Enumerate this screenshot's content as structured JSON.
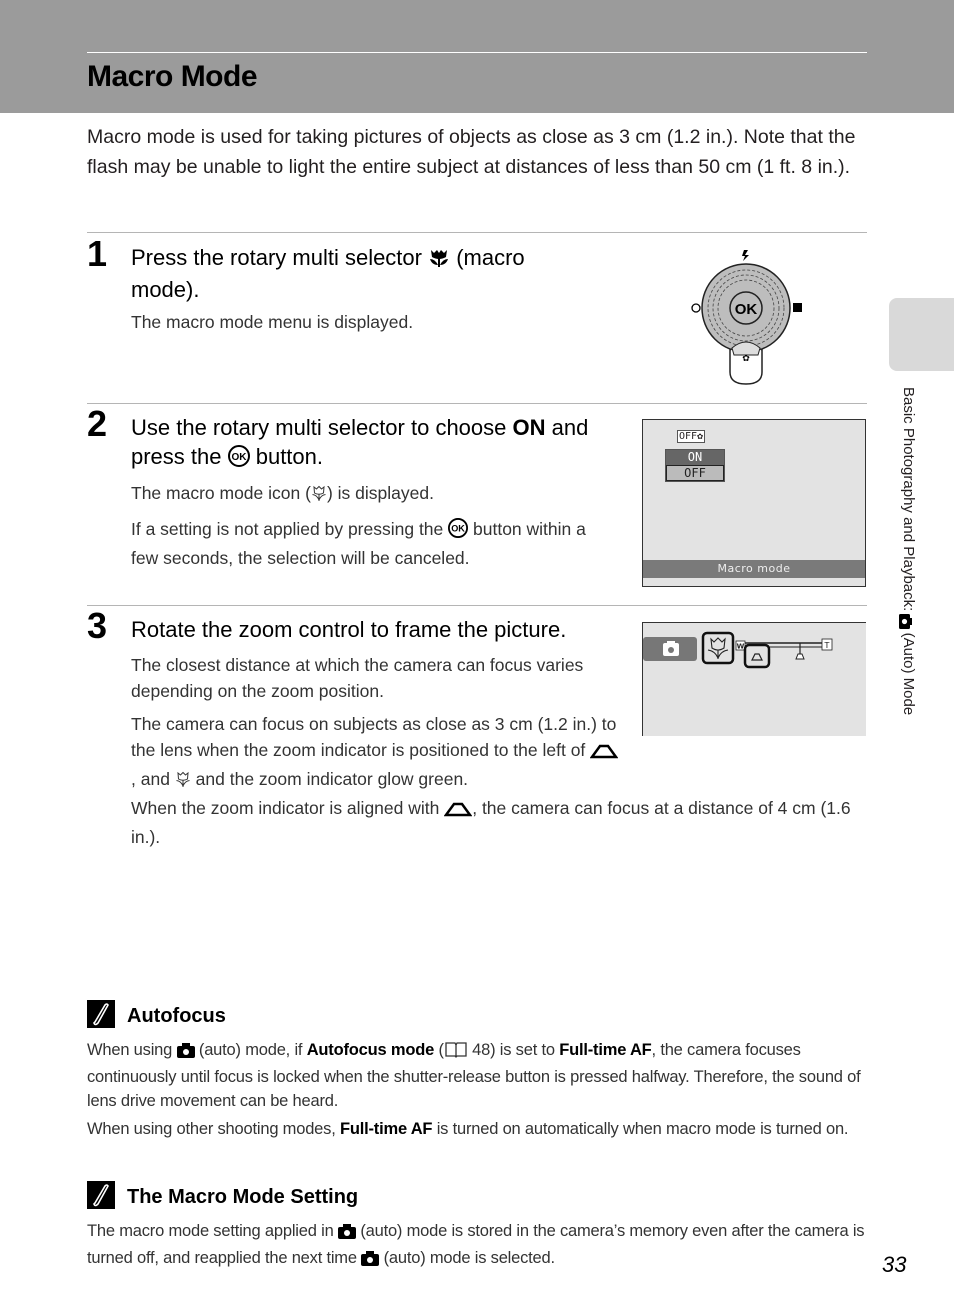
{
  "header": {
    "title": "Macro Mode"
  },
  "intro": "Macro mode is used for taking pictures of objects as close as 3 cm (1.2 in.). Note that the flash may be unable to light the entire subject at distances of less than 50 cm (1 ft. 8 in.).",
  "side_tab": {
    "label_before": "Basic Photography and Playback: ",
    "icon": "camera-icon",
    "label_after": " (Auto) Mode"
  },
  "steps": [
    {
      "number": "1",
      "title_before": "Press the rotary multi selector ",
      "title_icon": "macro-flower-icon",
      "title_after": " (macro mode).",
      "paragraphs": [
        "The macro mode menu is displayed."
      ]
    },
    {
      "number": "2",
      "title_before": "Use the rotary multi selector to choose ",
      "title_bold": "ON",
      "title_middle": " and press the ",
      "title_icon": "ok-button-icon",
      "title_after": " button.",
      "p1_before": "The macro mode icon (",
      "p1_icon": "macro-icon",
      "p1_after": ") is displayed.",
      "p2_before": "If a setting is not applied by pressing the ",
      "p2_icon": "ok-button-icon",
      "p2_after": " button within a few seconds, the selection will be canceled."
    },
    {
      "number": "3",
      "title": "Rotate the zoom control to frame the picture.",
      "p1": "The closest distance at which the camera can focus varies depending on the zoom position.",
      "p2_before": "The camera can focus on subjects as close as 3 cm (1.2 in.) to the lens when the zoom indicator is positioned to the left of ",
      "p2_icon1": "triangle-marker-icon",
      "p2_mid": ", and ",
      "p2_icon2": "macro-icon",
      "p2_after": " and the zoom indicator glow green.",
      "p3_before": "When the zoom indicator is aligned with ",
      "p3_icon": "triangle-marker-icon",
      "p3_after": ", the camera can focus at a distance of 4 cm (1.6 in.)."
    }
  ],
  "selector_diagram": {
    "center_label": "OK"
  },
  "macro_screen": {
    "menu_options": [
      "ON",
      "OFF"
    ],
    "selected": "OFF",
    "banner": "Macro mode"
  },
  "zoom_screen": {
    "wide_label": "W",
    "tele_label": "T"
  },
  "notes": [
    {
      "title": "Autofocus",
      "p1_a": "When using ",
      "p1_b": " (auto) mode, if ",
      "p1_bold1": "Autofocus mode",
      "p1_c": " (",
      "p1_ref": " 48) is set to ",
      "p1_bold2": "Full-time AF",
      "p1_d": ", the camera focuses continuously until focus is locked when the shutter-release button is pressed halfway. Therefore, the sound of lens drive movement can be heard.",
      "p2_a": "When using other shooting modes, ",
      "p2_bold": "Full-time AF",
      "p2_b": " is turned on automatically when macro mode is turned on."
    },
    {
      "title": "The Macro Mode Setting",
      "p1_a": "The macro mode setting applied in ",
      "p1_b": " (auto) mode is stored in the camera’s memory even after the camera is turned off, and reapplied the next time ",
      "p1_c": " (auto) mode is selected."
    }
  ],
  "page_number": "33"
}
